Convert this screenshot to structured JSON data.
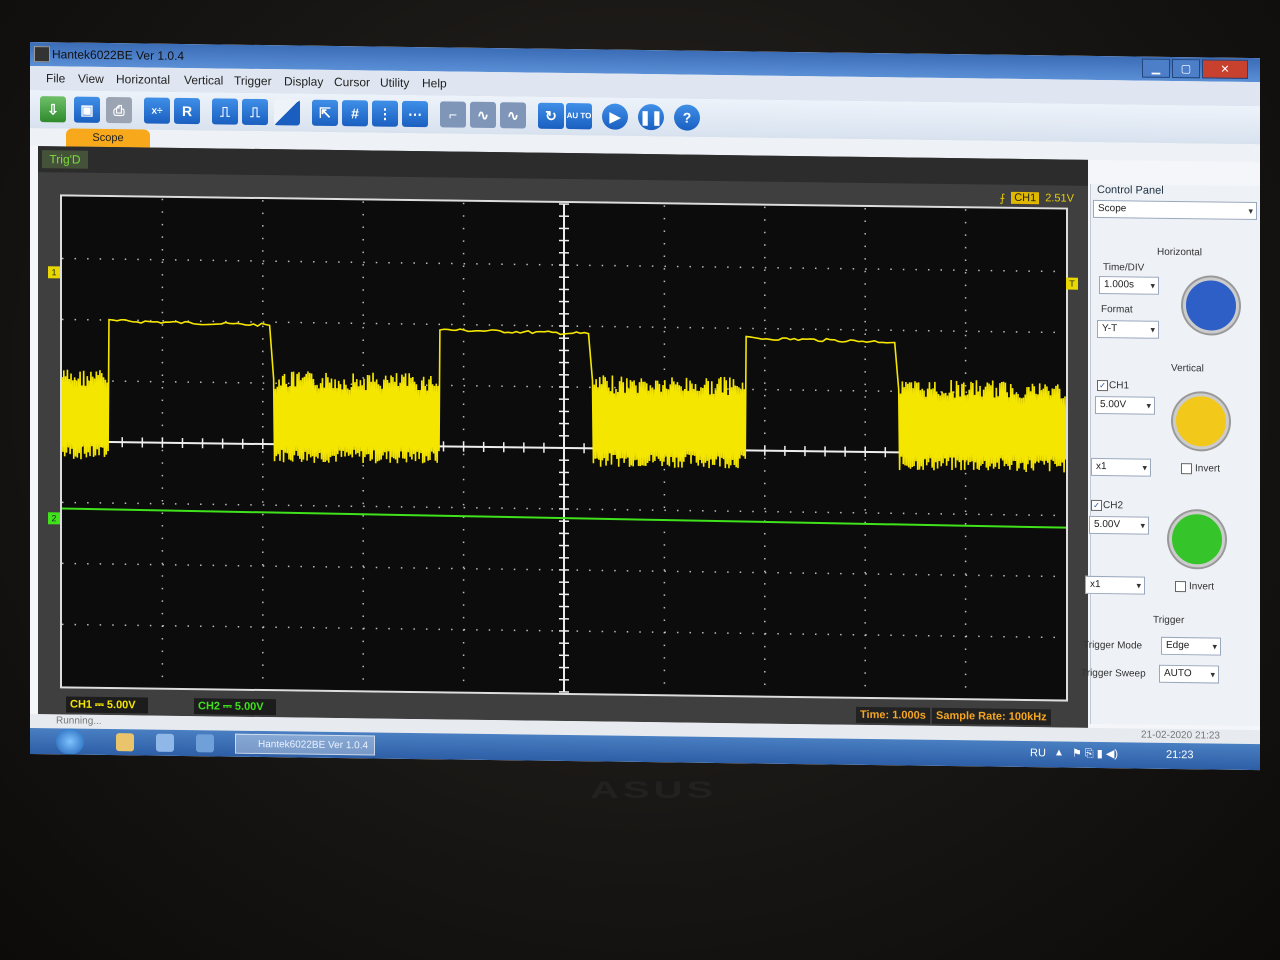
{
  "window": {
    "title": "Hantek6022BE Ver 1.0.4"
  },
  "menu": [
    "File",
    "View",
    "Horizontal",
    "Vertical",
    "Trigger",
    "Display",
    "Cursor",
    "Utility",
    "Help"
  ],
  "toolbar": {
    "r_label": "R",
    "auto_label": "AU TO",
    "help_label": "?"
  },
  "tab": {
    "label": "Scope"
  },
  "scope": {
    "trig_state": "Trig'D",
    "trigger": {
      "channel": "CH1",
      "level": "2.51V"
    },
    "markers": {
      "ch1": "1",
      "ch2": "2",
      "trig": "T"
    },
    "ch1_status": "CH1 ⎓ 5.00V",
    "ch2_status": "CH2 ⎓ 5.00V",
    "time": "Time: 1.000s",
    "sample_rate": "Sample Rate: 100kHz",
    "colors": {
      "ch1": "#f5e600",
      "ch2": "#3fe21b",
      "grid": "#d9d9d9"
    }
  },
  "chart_data": {
    "type": "line",
    "x_divisions": 10,
    "y_divisions": 8,
    "time_per_div_s": 1.0,
    "series": [
      {
        "name": "CH1",
        "volts_per_div": 5.0,
        "baseline_div": 2.0,
        "bursts_div": [
          [
            0.0,
            0.45
          ],
          [
            2.1,
            3.75
          ],
          [
            5.25,
            6.8
          ],
          [
            8.3,
            10.0
          ]
        ],
        "burst_peak_div": 1.2,
        "burst_trough_div": -0.3
      },
      {
        "name": "CH2",
        "volts_per_div": 5.0,
        "level_div": -1.1
      }
    ]
  },
  "panel": {
    "title": "Control Panel",
    "mode_select": "Scope",
    "horizontal_label": "Horizontal",
    "time_div_label": "Time/DIV",
    "time_div_value": "1.000s",
    "format_label": "Format",
    "format_value": "Y-T",
    "vertical_label": "Vertical",
    "ch1_label": "CH1",
    "ch1_volts": "5.00V",
    "ch1_probe": "x1",
    "ch1_invert": "Invert",
    "ch2_label": "CH2",
    "ch2_volts": "5.00V",
    "ch2_probe": "x1",
    "ch2_invert": "Invert",
    "trigger_label": "Trigger",
    "trigger_mode_label": "Trigger Mode",
    "trigger_mode_value": "Edge",
    "trigger_sweep_label": "Trigger Sweep",
    "trigger_sweep_value": "AUTO",
    "knob_colors": {
      "horizontal": "#2d5fc7",
      "ch1": "#f2c81a",
      "ch2": "#35c42a"
    }
  },
  "statusbar": {
    "text": "Running..."
  },
  "taskbar": {
    "lang": "RU",
    "time": "21:23",
    "date_time": "21-02-2020  21:23"
  },
  "laptop": {
    "brand": "ASUS"
  }
}
